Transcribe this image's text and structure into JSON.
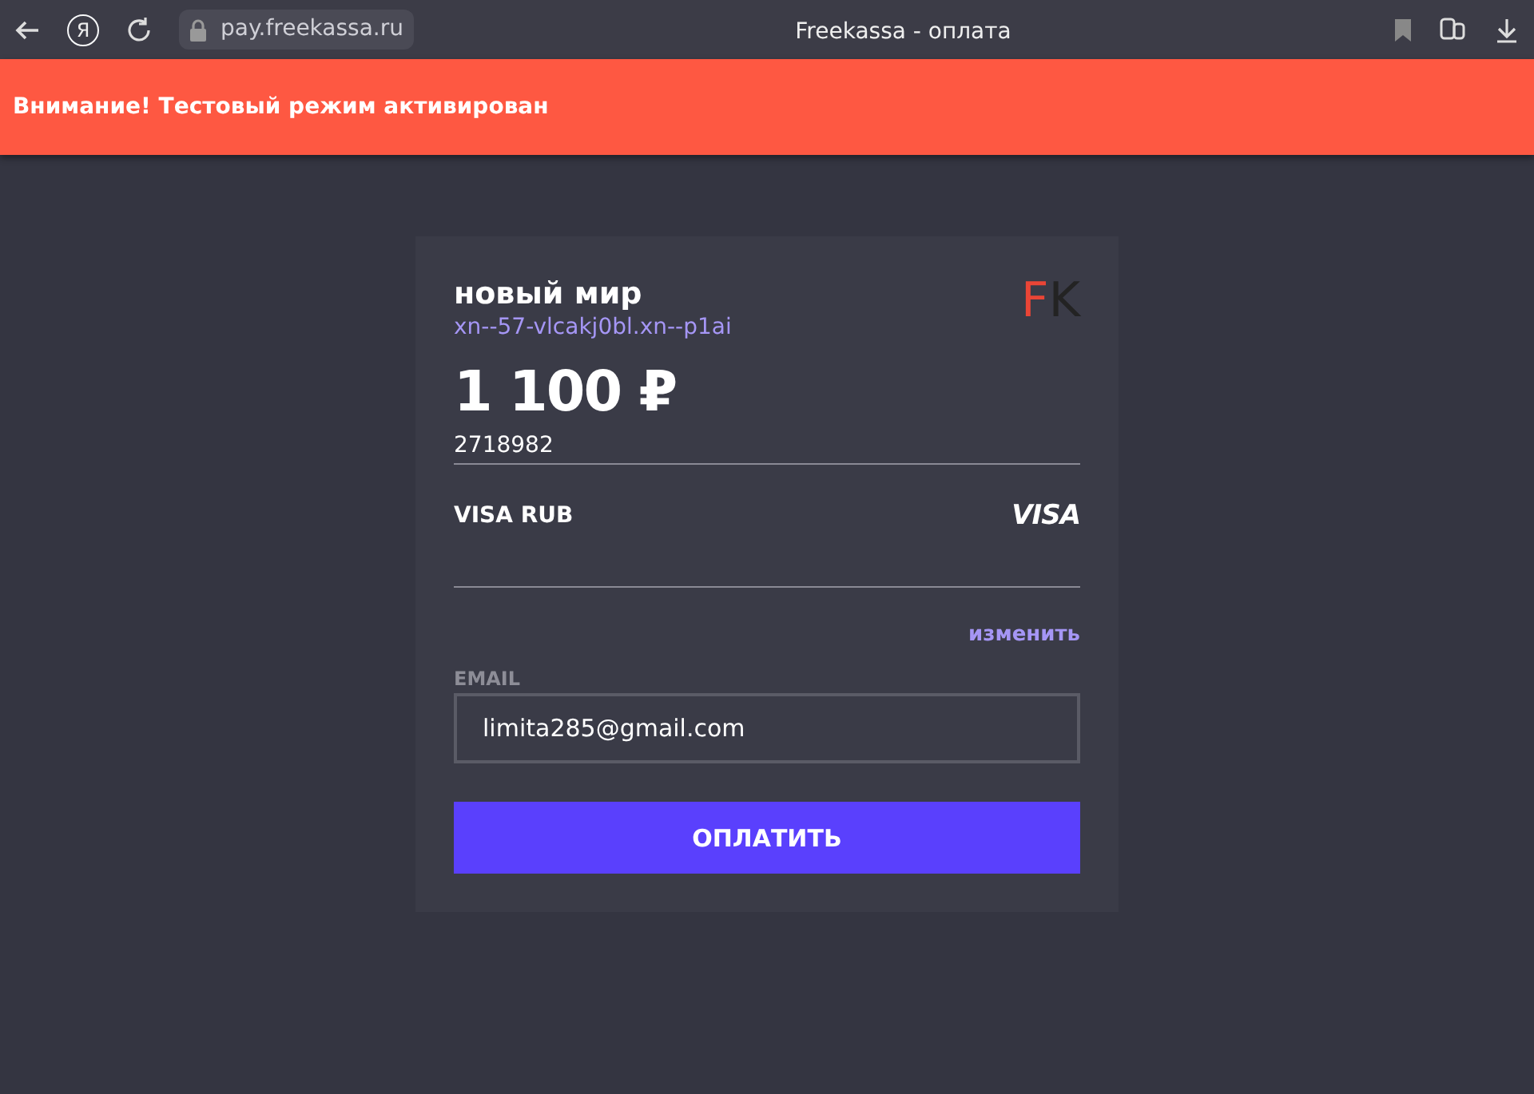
{
  "browser": {
    "logo_letter": "Я",
    "url": "pay.freekassa.ru",
    "title": "Freekassa - оплата"
  },
  "alert": {
    "text": "Внимание! Тестовый режим активирован"
  },
  "payment": {
    "merchant": "новый мир",
    "domain": "xn--57-vlcakj0bl.xn--p1ai",
    "logo": [
      "F",
      "K"
    ],
    "amount": "1 100",
    "currency": "₽",
    "order": "2718982",
    "method": {
      "name": "VISA RUB",
      "brand": "VISA"
    },
    "change": "изменить",
    "email_label": "EMAIL",
    "email": "limita285@gmail.com",
    "pay_button": "ОПЛАТИТЬ"
  }
}
